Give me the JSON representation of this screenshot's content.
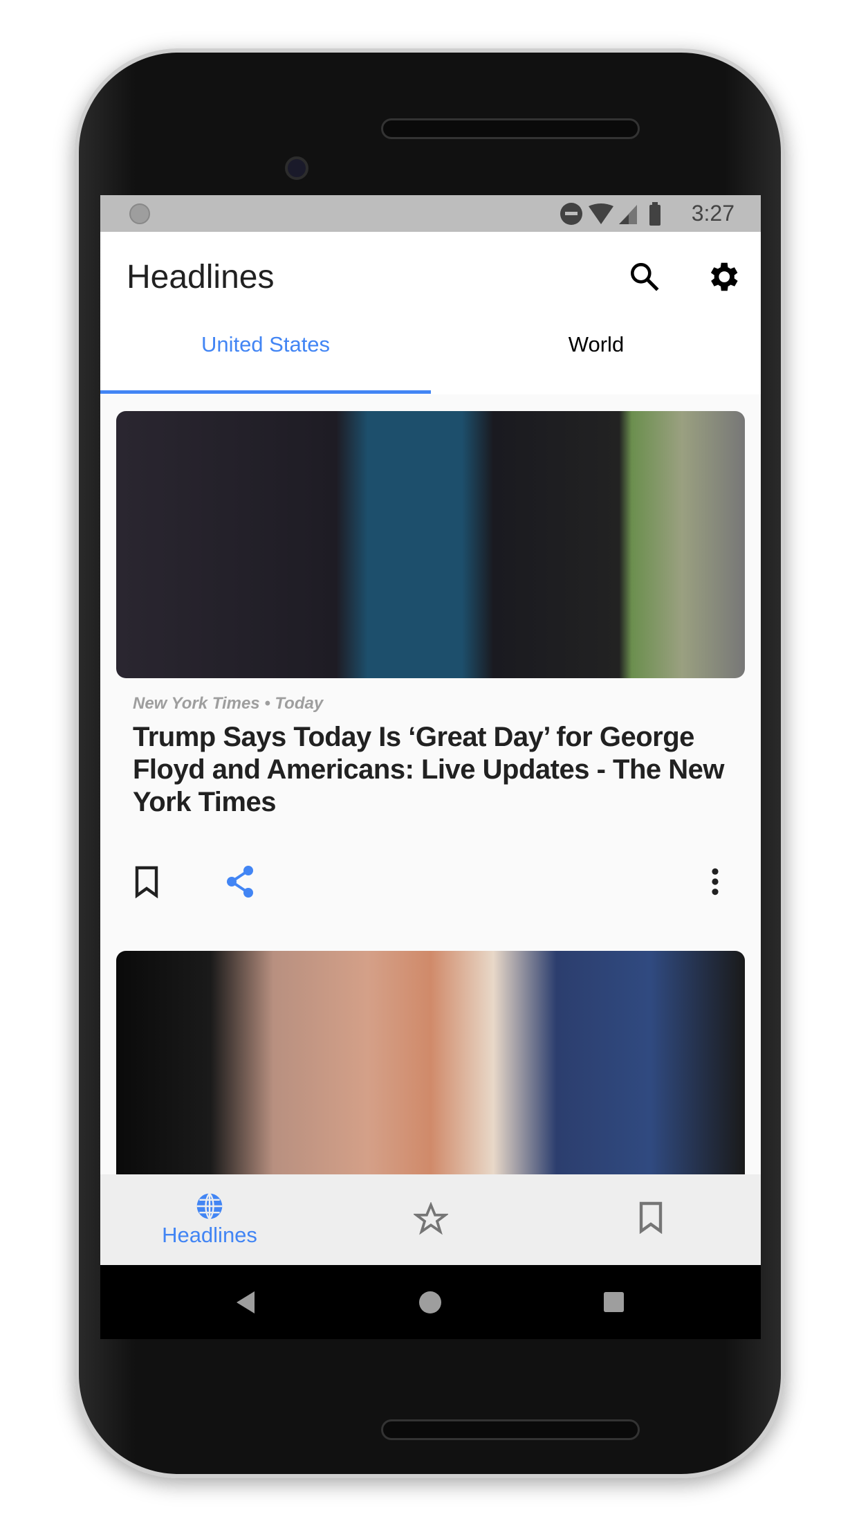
{
  "status_bar": {
    "time": "3:27"
  },
  "app_bar": {
    "title": "Headlines"
  },
  "tabs": [
    {
      "label": "United States",
      "active": true
    },
    {
      "label": "World",
      "active": false
    }
  ],
  "articles": [
    {
      "source_date": "New York Times • Today",
      "title": "Trump Says Today Is ‘Great Day’ for George Floyd and Americans: Live Updates - The New York Times"
    }
  ],
  "bottom_nav": [
    {
      "label": "Headlines",
      "icon": "globe-icon",
      "active": true
    },
    {
      "label": "",
      "icon": "star-icon"
    },
    {
      "label": "",
      "icon": "bookmark-icon"
    }
  ],
  "colors": {
    "accent": "#4285f4",
    "text": "#212121",
    "meta": "#9e9e9e"
  }
}
